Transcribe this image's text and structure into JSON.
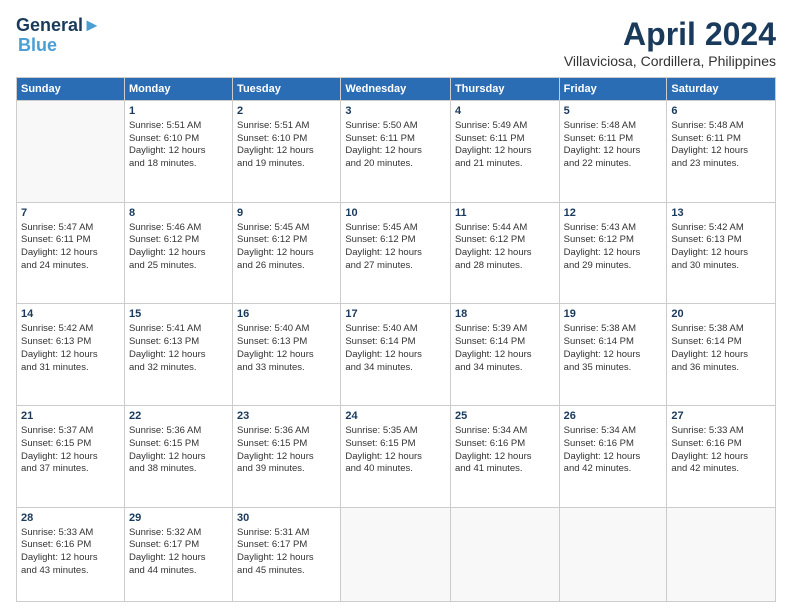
{
  "logo": {
    "line1": "General",
    "line2": "Blue"
  },
  "title": "April 2024",
  "subtitle": "Villaviciosa, Cordillera, Philippines",
  "weekdays": [
    "Sunday",
    "Monday",
    "Tuesday",
    "Wednesday",
    "Thursday",
    "Friday",
    "Saturday"
  ],
  "weeks": [
    [
      {
        "day": "",
        "info": ""
      },
      {
        "day": "1",
        "info": "Sunrise: 5:51 AM\nSunset: 6:10 PM\nDaylight: 12 hours\nand 18 minutes."
      },
      {
        "day": "2",
        "info": "Sunrise: 5:51 AM\nSunset: 6:10 PM\nDaylight: 12 hours\nand 19 minutes."
      },
      {
        "day": "3",
        "info": "Sunrise: 5:50 AM\nSunset: 6:11 PM\nDaylight: 12 hours\nand 20 minutes."
      },
      {
        "day": "4",
        "info": "Sunrise: 5:49 AM\nSunset: 6:11 PM\nDaylight: 12 hours\nand 21 minutes."
      },
      {
        "day": "5",
        "info": "Sunrise: 5:48 AM\nSunset: 6:11 PM\nDaylight: 12 hours\nand 22 minutes."
      },
      {
        "day": "6",
        "info": "Sunrise: 5:48 AM\nSunset: 6:11 PM\nDaylight: 12 hours\nand 23 minutes."
      }
    ],
    [
      {
        "day": "7",
        "info": "Sunrise: 5:47 AM\nSunset: 6:11 PM\nDaylight: 12 hours\nand 24 minutes."
      },
      {
        "day": "8",
        "info": "Sunrise: 5:46 AM\nSunset: 6:12 PM\nDaylight: 12 hours\nand 25 minutes."
      },
      {
        "day": "9",
        "info": "Sunrise: 5:45 AM\nSunset: 6:12 PM\nDaylight: 12 hours\nand 26 minutes."
      },
      {
        "day": "10",
        "info": "Sunrise: 5:45 AM\nSunset: 6:12 PM\nDaylight: 12 hours\nand 27 minutes."
      },
      {
        "day": "11",
        "info": "Sunrise: 5:44 AM\nSunset: 6:12 PM\nDaylight: 12 hours\nand 28 minutes."
      },
      {
        "day": "12",
        "info": "Sunrise: 5:43 AM\nSunset: 6:12 PM\nDaylight: 12 hours\nand 29 minutes."
      },
      {
        "day": "13",
        "info": "Sunrise: 5:42 AM\nSunset: 6:13 PM\nDaylight: 12 hours\nand 30 minutes."
      }
    ],
    [
      {
        "day": "14",
        "info": "Sunrise: 5:42 AM\nSunset: 6:13 PM\nDaylight: 12 hours\nand 31 minutes."
      },
      {
        "day": "15",
        "info": "Sunrise: 5:41 AM\nSunset: 6:13 PM\nDaylight: 12 hours\nand 32 minutes."
      },
      {
        "day": "16",
        "info": "Sunrise: 5:40 AM\nSunset: 6:13 PM\nDaylight: 12 hours\nand 33 minutes."
      },
      {
        "day": "17",
        "info": "Sunrise: 5:40 AM\nSunset: 6:14 PM\nDaylight: 12 hours\nand 34 minutes."
      },
      {
        "day": "18",
        "info": "Sunrise: 5:39 AM\nSunset: 6:14 PM\nDaylight: 12 hours\nand 34 minutes."
      },
      {
        "day": "19",
        "info": "Sunrise: 5:38 AM\nSunset: 6:14 PM\nDaylight: 12 hours\nand 35 minutes."
      },
      {
        "day": "20",
        "info": "Sunrise: 5:38 AM\nSunset: 6:14 PM\nDaylight: 12 hours\nand 36 minutes."
      }
    ],
    [
      {
        "day": "21",
        "info": "Sunrise: 5:37 AM\nSunset: 6:15 PM\nDaylight: 12 hours\nand 37 minutes."
      },
      {
        "day": "22",
        "info": "Sunrise: 5:36 AM\nSunset: 6:15 PM\nDaylight: 12 hours\nand 38 minutes."
      },
      {
        "day": "23",
        "info": "Sunrise: 5:36 AM\nSunset: 6:15 PM\nDaylight: 12 hours\nand 39 minutes."
      },
      {
        "day": "24",
        "info": "Sunrise: 5:35 AM\nSunset: 6:15 PM\nDaylight: 12 hours\nand 40 minutes."
      },
      {
        "day": "25",
        "info": "Sunrise: 5:34 AM\nSunset: 6:16 PM\nDaylight: 12 hours\nand 41 minutes."
      },
      {
        "day": "26",
        "info": "Sunrise: 5:34 AM\nSunset: 6:16 PM\nDaylight: 12 hours\nand 42 minutes."
      },
      {
        "day": "27",
        "info": "Sunrise: 5:33 AM\nSunset: 6:16 PM\nDaylight: 12 hours\nand 42 minutes."
      }
    ],
    [
      {
        "day": "28",
        "info": "Sunrise: 5:33 AM\nSunset: 6:16 PM\nDaylight: 12 hours\nand 43 minutes."
      },
      {
        "day": "29",
        "info": "Sunrise: 5:32 AM\nSunset: 6:17 PM\nDaylight: 12 hours\nand 44 minutes."
      },
      {
        "day": "30",
        "info": "Sunrise: 5:31 AM\nSunset: 6:17 PM\nDaylight: 12 hours\nand 45 minutes."
      },
      {
        "day": "",
        "info": ""
      },
      {
        "day": "",
        "info": ""
      },
      {
        "day": "",
        "info": ""
      },
      {
        "day": "",
        "info": ""
      }
    ]
  ]
}
